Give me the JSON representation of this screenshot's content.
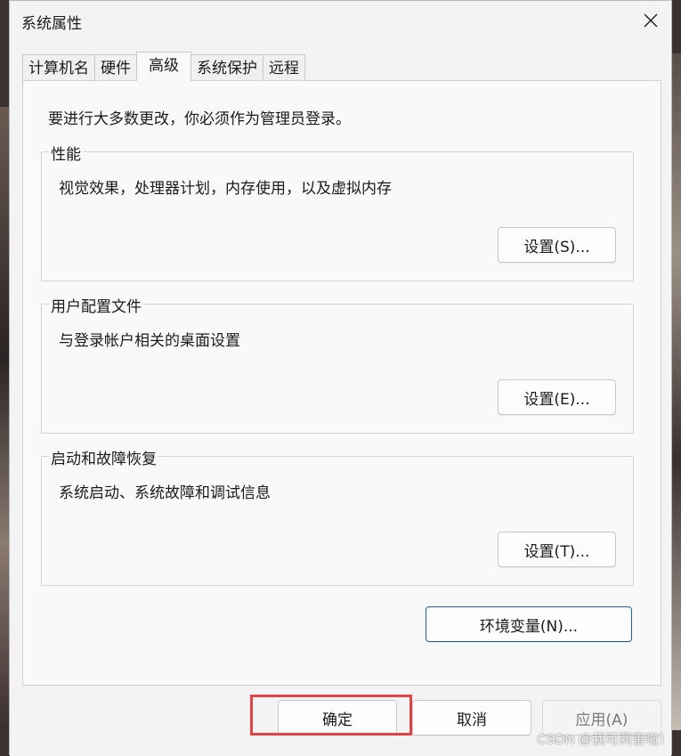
{
  "window": {
    "title": "系统属性"
  },
  "tabs": [
    {
      "label": "计算机名",
      "active": false
    },
    {
      "label": "硬件",
      "active": false
    },
    {
      "label": "高级",
      "active": true
    },
    {
      "label": "系统保护",
      "active": false
    },
    {
      "label": "远程",
      "active": false
    }
  ],
  "advanced": {
    "notice": "要进行大多数更改，你必须作为管理员登录。",
    "performance": {
      "title": "性能",
      "desc": "视觉效果，处理器计划，内存使用，以及虚拟内存",
      "button": "设置(S)..."
    },
    "profiles": {
      "title": "用户配置文件",
      "desc": "与登录帐户相关的桌面设置",
      "button": "设置(E)..."
    },
    "startup": {
      "title": "启动和故障恢复",
      "desc": "系统启动、系统故障和调试信息",
      "button": "设置(T)..."
    },
    "env_button": "环境变量(N)..."
  },
  "footer": {
    "ok": "确定",
    "cancel": "取消",
    "apply": "应用(A)"
  },
  "watermark": "CSDN @我可莉害啦！",
  "colors": {
    "highlight": "#e04545",
    "focus_border": "#1a5fa8",
    "dialog_bg": "#f3f3f3"
  },
  "icons": {
    "close": "close-icon"
  }
}
